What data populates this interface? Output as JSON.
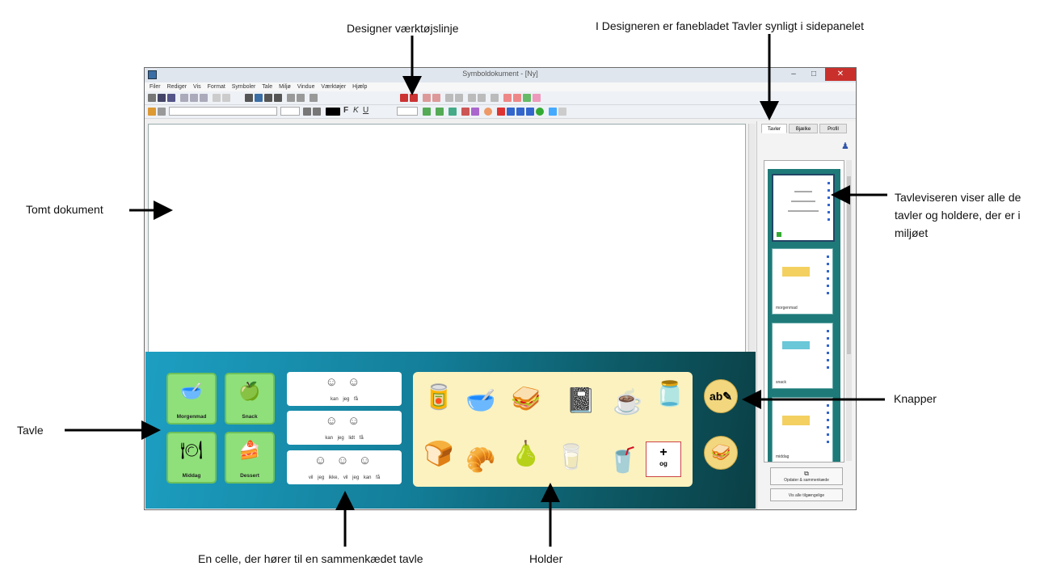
{
  "callouts": {
    "designer_toolbar": "Designer værktøjslinje",
    "side_panel_tab": "I Designeren er fanebladet Tavler synligt i sidepanelet",
    "empty_document": "Tomt dokument",
    "board_viewer": "Tavleviseren viser alle de tavler og holdere, der er i miljøet",
    "buttons": "Knapper",
    "board": "Tavle",
    "linked_cell": "En celle, der hører til en sammenkædet tavle",
    "holder": "Holder"
  },
  "window": {
    "title": "Symboldokument - [Ny]"
  },
  "menu": [
    "Filer",
    "Rediger",
    "Vis",
    "Format",
    "Symboler",
    "Tale",
    "Miljø",
    "Vindue",
    "Værktøjer",
    "Hjælp"
  ],
  "side_panel": {
    "tabs": [
      "Tavler",
      "Bjælke",
      "Profil"
    ],
    "bottom_buttons": [
      "Opdater & sammenkæde",
      "Vis alle tilgængelige"
    ]
  },
  "board_viewer": {
    "thumbnails": [
      "",
      "morgenmad",
      "snack",
      "middag"
    ]
  },
  "board": {
    "group_buttons": [
      "Morgenmad",
      "Snack",
      "Middag",
      "Dessert"
    ],
    "group_icons": [
      "bowl-icon",
      "apple-icon",
      "plate-icon",
      "cake-icon"
    ],
    "linked_cells": [
      "kan jeg få",
      "kan jeg lidt få",
      "vil jeg ikke, vil jeg kan få"
    ],
    "holder_symbols": [
      "cereal-icon",
      "bowl-icon",
      "sandwich-icon",
      "notebook-icon",
      "teapot-icon",
      "jar-icon",
      "toaster-icon",
      "croissant-icon",
      "apple-pear-icon",
      "yogurt-icon",
      "glass-icon"
    ],
    "plus_cell": {
      "symbol": "+",
      "word": "og"
    },
    "round_buttons": [
      "abc-pen-icon",
      "sandwich-icon"
    ]
  },
  "colors": {
    "board_start": "#1d9fc2",
    "board_end": "#0b3f45",
    "group_button": "#8fe07a",
    "holder": "#fbf2bf"
  }
}
